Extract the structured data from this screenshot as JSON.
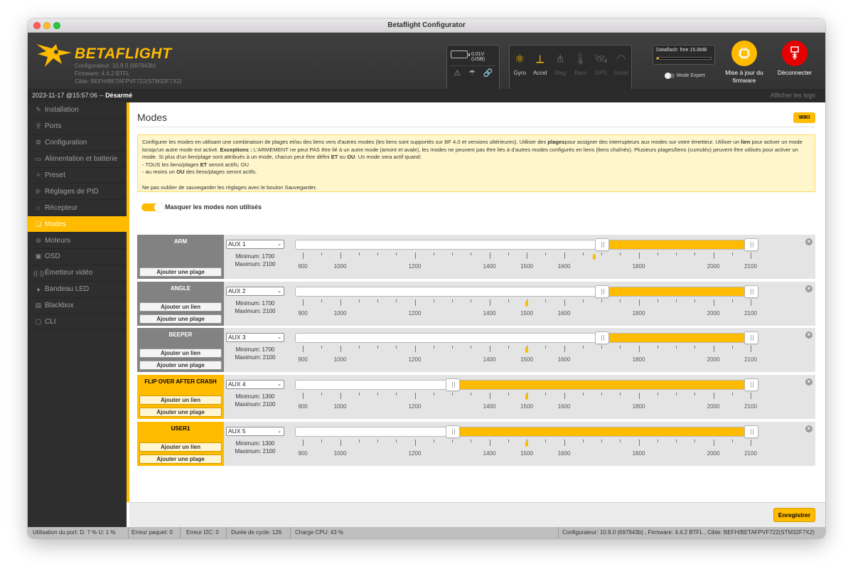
{
  "window": {
    "title": "Betaflight Configurator"
  },
  "header": {
    "logo_text": "BETAFLIGHT",
    "configurator": "Configurateur: 10.9.0 (697943b)",
    "firmware": "Firmware: 4.4.2 BTFL",
    "target": "Cible: BEFH/BETAFPVF722(STM32F7X2)",
    "battery": "0.01V (USB)",
    "sensors": [
      {
        "label": "Gyro",
        "icon": "gyro-icon",
        "active": true
      },
      {
        "label": "Accel",
        "icon": "accel-icon",
        "active": true
      },
      {
        "label": "Mag",
        "icon": "mag-icon",
        "active": false
      },
      {
        "label": "Baro",
        "icon": "baro-icon",
        "active": false
      },
      {
        "label": "GPS",
        "icon": "gps-icon",
        "active": false
      },
      {
        "label": "Sonar",
        "icon": "sonar-icon",
        "active": false
      }
    ],
    "dataflash": "Dataflash: free 15.8MB",
    "expert_mode": "Mode Expert",
    "flash_firmware": "Mise à jour du firmware",
    "disconnect": "Déconnecter"
  },
  "status_strip": {
    "datetime": "2023-11-17 @15:57:06 --",
    "arm_state": "Désarmé",
    "show_logs": "Afficher les logs"
  },
  "sidebar": {
    "items": [
      {
        "label": "Installation",
        "icon": "wrench-icon"
      },
      {
        "label": "Ports",
        "icon": "plug-icon"
      },
      {
        "label": "Configuration",
        "icon": "gear-icon"
      },
      {
        "label": "Alimentation et batterie",
        "icon": "battery-icon"
      },
      {
        "label": "Preset",
        "icon": "magic-wand-icon"
      },
      {
        "label": "Réglages de PID",
        "icon": "sliders-icon"
      },
      {
        "label": "Récepteur",
        "icon": "receiver-icon"
      },
      {
        "label": "Modes",
        "icon": "modes-icon",
        "active": true
      },
      {
        "label": "Moteurs",
        "icon": "motor-icon"
      },
      {
        "label": "OSD",
        "icon": "osd-icon"
      },
      {
        "label": "Émetteur vidéo",
        "icon": "vtx-icon"
      },
      {
        "label": "Bandeau LED",
        "icon": "led-icon"
      },
      {
        "label": "Blackbox",
        "icon": "blackbox-icon"
      },
      {
        "label": "CLI",
        "icon": "cli-icon"
      }
    ]
  },
  "main": {
    "title": "Modes",
    "wiki": "WIKI",
    "note": {
      "p1a": "Configurer les modes en utilisant une combinaison de plages et/ou des liens vers d'autres modes (les liens sont supportés sur BF 4.0 et versions ultérieures). Utiliser des ",
      "p1b": "plages",
      "p1c": "pour assigner des interrupteurs aux modes sur votre émetteur. Utiliser un ",
      "p1d": "lien",
      "p1e": " pour activer un mode lorsqu'un autre mode est activé. ",
      "p1f": "Exceptions :",
      "p1g": " L'ARMEMENT ne peut PAS être lié à un autre mode (amont et avale), les modes ne peuvent pas être liés à d'autres modes configurés en liens (liens chaînés). Plusieurs plages/liens (cumulés) peuvent être utilisés pour activer un mode. Si plus d'un lien/plage sont attribués à un mode, chacun peut être défini ",
      "p1h": "ET",
      "p1i": " ou ",
      "p1j": "OU",
      "p1k": ". Un mode sera actif quand:",
      "l1a": "- TOUS les liens/plages ",
      "l1b": "ET",
      "l1c": " seront actifs; OU",
      "l2a": "- au moins un ",
      "l2b": "OU",
      "l2c": " des liens/plages seront actifs.",
      "p2": "Ne pas oublier de sauvegarder les réglages avec le bouton Sauvegarder."
    },
    "hide_unused": "Masquer les modes non utilisés",
    "scale": {
      "min": 900,
      "max": 2100,
      "labels": [
        "900",
        "1000",
        "1200",
        "1400",
        "1500",
        "1600",
        "1800",
        "2000",
        "2100"
      ],
      "label_values": [
        900,
        1000,
        1200,
        1400,
        1500,
        1600,
        1800,
        2000,
        2100
      ]
    },
    "add_link": "Ajouter un lien",
    "add_range": "Ajouter une plage",
    "min_label": "Minimum:",
    "max_label": "Maximum:",
    "modes": [
      {
        "name": "ARM",
        "aux": "AUX 1",
        "min": 1700,
        "max": 2100,
        "min_text": "1700",
        "max_text": "2100",
        "channel_value": 1680,
        "active": false,
        "has_link": false
      },
      {
        "name": "ANGLE",
        "aux": "AUX 2",
        "min": 1700,
        "max": 2100,
        "min_text": "1700",
        "max_text": "2100",
        "channel_value": 1500,
        "active": false,
        "has_link": true
      },
      {
        "name": "BEEPER",
        "aux": "AUX 3",
        "min": 1700,
        "max": 2100,
        "min_text": "1700",
        "max_text": "2100",
        "channel_value": 1500,
        "active": false,
        "has_link": true
      },
      {
        "name": "FLIP OVER AFTER CRASH",
        "aux": "AUX 4",
        "min": 1300,
        "max": 2100,
        "min_text": "1300",
        "max_text": "2100",
        "channel_value": 1500,
        "active": true,
        "has_link": true
      },
      {
        "name": "USER1",
        "aux": "AUX 5",
        "min": 1300,
        "max": 2100,
        "min_text": "1300",
        "max_text": "2100",
        "channel_value": 1500,
        "active": true,
        "has_link": true
      }
    ],
    "save": "Enregistrer"
  },
  "status_bar": {
    "port_usage": "Utilisation du port: D: 7 % U: 1 %",
    "packet_error": "Erreur paquet: 0",
    "i2c_error": "Erreur I2C: 0",
    "cycle_time": "Durée de cycle: 126",
    "cpu_load": "Charge CPU: 43 %",
    "versions": "Configurateur: 10.9.0 (697943b) , Firmware: 4.4.2 BTFL , Cible: BEFH/BETAFPVF722(STM32F7X2)"
  },
  "colors": {
    "accent": "#ffbb00",
    "danger": "#e60000",
    "sidebar": "#2e2e2e",
    "header": "#3a3a3a"
  }
}
